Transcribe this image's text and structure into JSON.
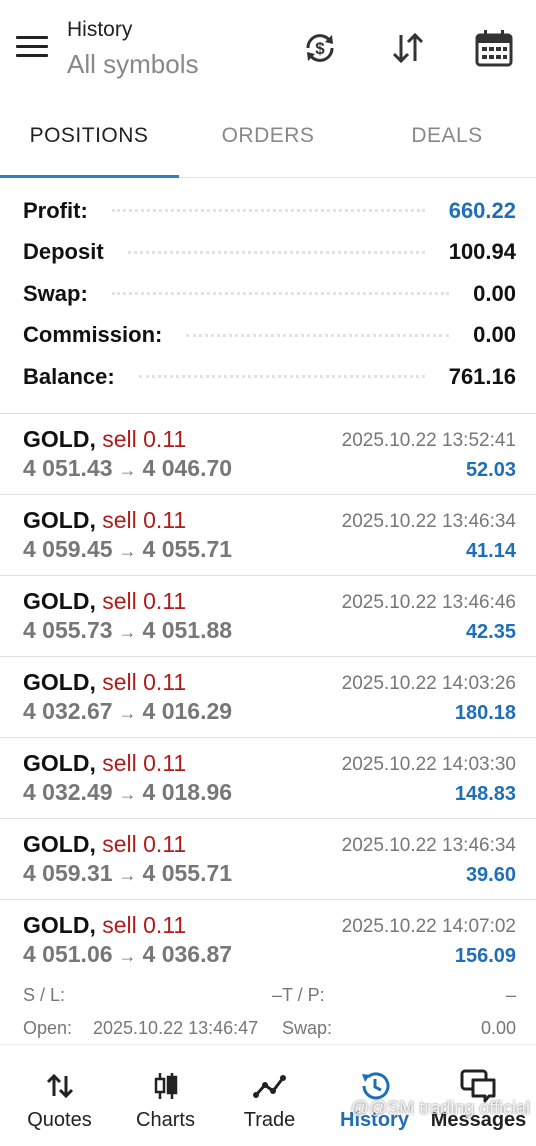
{
  "header": {
    "title": "History",
    "subtitle": "All symbols",
    "icons": [
      "currency-sync-icon",
      "sort-icon",
      "calendar-icon"
    ]
  },
  "tabs": [
    {
      "label": "POSITIONS",
      "active": true
    },
    {
      "label": "ORDERS",
      "active": false
    },
    {
      "label": "DEALS",
      "active": false
    }
  ],
  "summary": [
    {
      "label": "Profit:",
      "value": "660.22"
    },
    {
      "label": "Deposit",
      "value": "100.94"
    },
    {
      "label": "Swap:",
      "value": "0.00"
    },
    {
      "label": "Commission:",
      "value": "0.00"
    },
    {
      "label": "Balance:",
      "value": "761.16"
    }
  ],
  "deals": [
    {
      "symbol": "GOLD,",
      "side": "sell 0.11",
      "time": "2025.10.22 13:52:41",
      "open": "4 051.43",
      "close": "4 046.70",
      "profit": "52.03"
    },
    {
      "symbol": "GOLD,",
      "side": "sell 0.11",
      "time": "2025.10.22 13:46:34",
      "open": "4 059.45",
      "close": "4 055.71",
      "profit": "41.14"
    },
    {
      "symbol": "GOLD,",
      "side": "sell 0.11",
      "time": "2025.10.22 13:46:46",
      "open": "4 055.73",
      "close": "4 051.88",
      "profit": "42.35"
    },
    {
      "symbol": "GOLD,",
      "side": "sell 0.11",
      "time": "2025.10.22 14:03:26",
      "open": "4 032.67",
      "close": "4 016.29",
      "profit": "180.18"
    },
    {
      "symbol": "GOLD,",
      "side": "sell 0.11",
      "time": "2025.10.22 14:03:30",
      "open": "4 032.49",
      "close": "4 018.96",
      "profit": "148.83"
    },
    {
      "symbol": "GOLD,",
      "side": "sell 0.11",
      "time": "2025.10.22 13:46:34",
      "open": "4 059.31",
      "close": "4 055.71",
      "profit": "39.60"
    },
    {
      "symbol": "GOLD,",
      "side": "sell 0.11",
      "time": "2025.10.22 14:07:02",
      "open": "4 051.06",
      "close": "4 036.87",
      "profit": "156.09"
    }
  ],
  "arrow": "→",
  "expanded": {
    "sl_label": "S / L:",
    "sl_value": "–",
    "tp_label": "T / P:",
    "tp_value": "–",
    "open_label": "Open:",
    "open_value": "2025.10.22 13:46:47",
    "swap_label": "Swap:",
    "swap_value": "0.00"
  },
  "nav": [
    {
      "label": "Quotes",
      "icon": "quotes-icon",
      "active": false
    },
    {
      "label": "Charts",
      "icon": "charts-icon",
      "active": false
    },
    {
      "label": "Trade",
      "icon": "trade-icon",
      "active": false
    },
    {
      "label": "History",
      "icon": "history-icon",
      "active": true
    },
    {
      "label": "Messages",
      "icon": "messages-icon",
      "active": false
    }
  ],
  "watermark": "@@SM trading official",
  "colors": {
    "accent": "#1e6fb8",
    "sell": "#b01c1c",
    "muted": "#777777"
  }
}
